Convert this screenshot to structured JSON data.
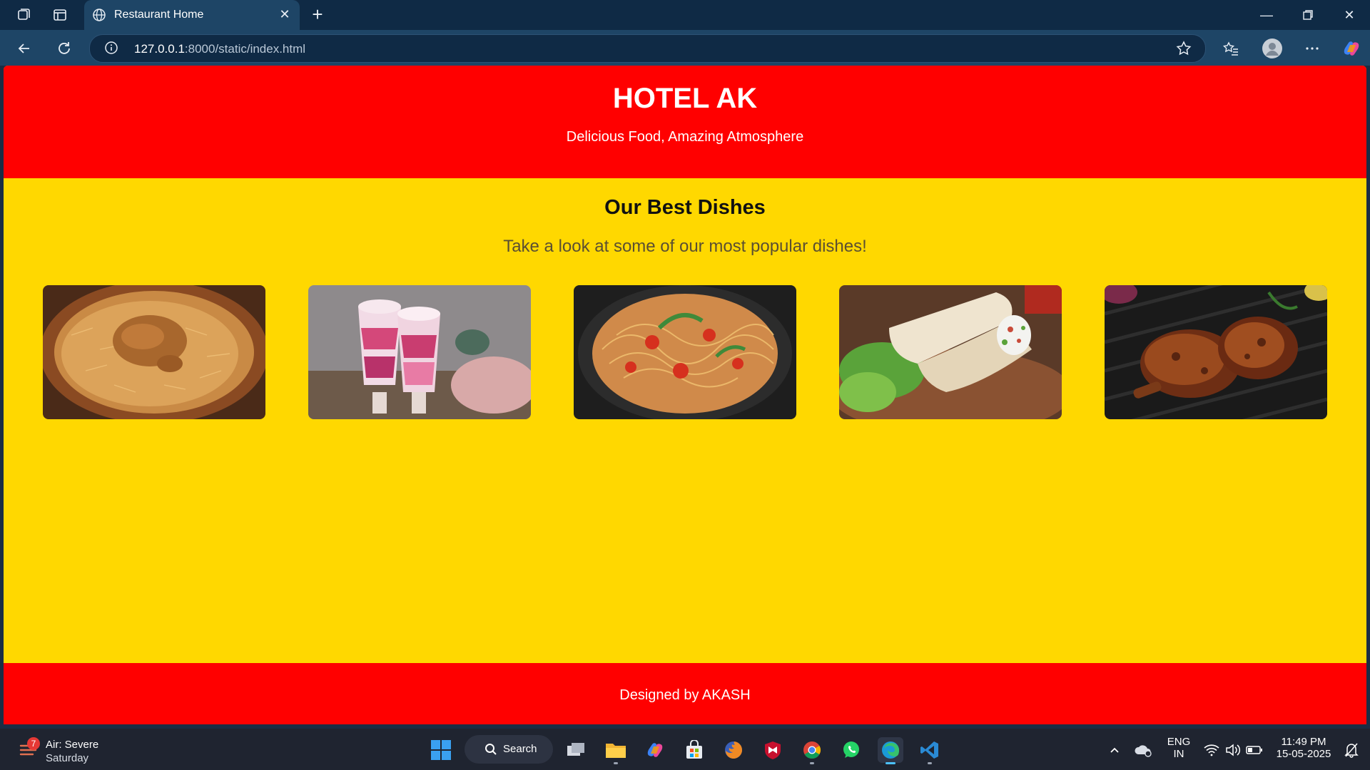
{
  "browser": {
    "tab_title": "Restaurant Home",
    "url_host": "127.0.0.1",
    "url_rest": ":8000/static/index.html"
  },
  "page": {
    "hero": {
      "title": "HOTEL AK",
      "tagline": "Delicious Food, Amazing Atmosphere"
    },
    "dishes": {
      "heading": "Our Best Dishes",
      "subheading": "Take a look at some of our most popular dishes!",
      "images": [
        {
          "icon": "biryani-image"
        },
        {
          "icon": "falooda-image"
        },
        {
          "icon": "noodles-image"
        },
        {
          "icon": "wrap-image"
        },
        {
          "icon": "grilled-chicken-image"
        }
      ]
    },
    "footer": {
      "credit": "Designed by AKASH"
    }
  },
  "colors": {
    "header_red": "#ff0000",
    "body_yellow": "#ffd800",
    "chrome_dark": "#0f2a45",
    "chrome_mid": "#1e4566"
  },
  "taskbar": {
    "weather": {
      "badge": "7",
      "line1": "Air: Severe",
      "line2": "Saturday"
    },
    "search_label": "Search",
    "lang_top": "ENG",
    "lang_bottom": "IN",
    "time": "11:49 PM",
    "date": "15-05-2025"
  }
}
